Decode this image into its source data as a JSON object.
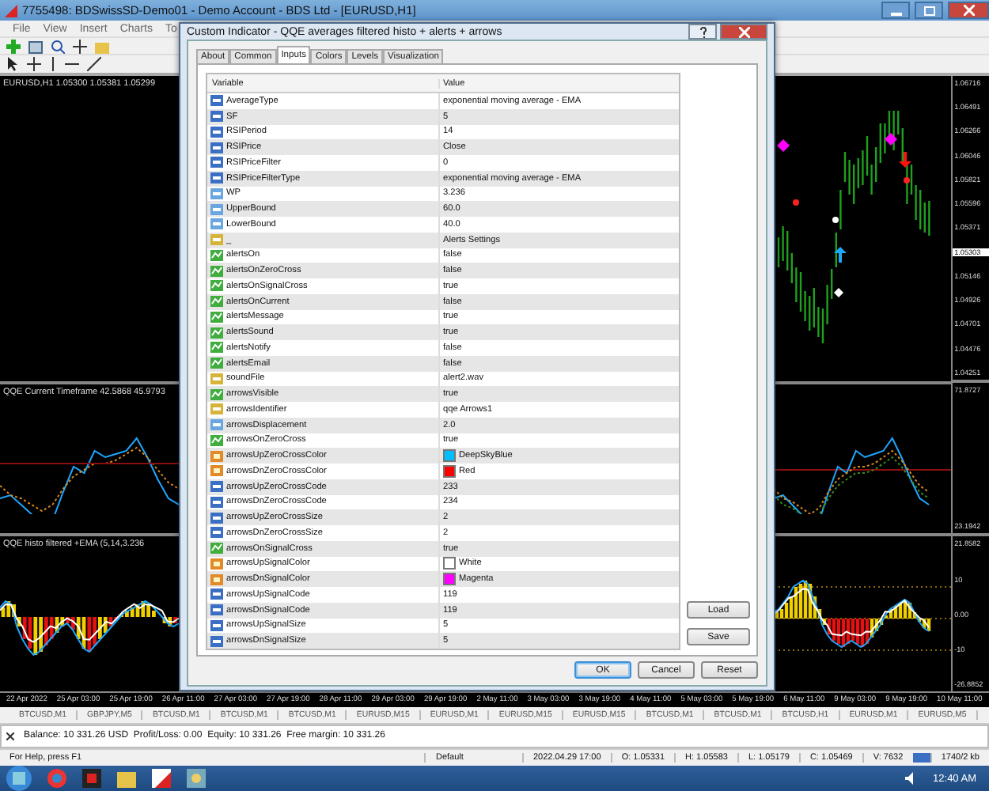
{
  "window": {
    "title": "7755498: BDSwissSD-Demo01 - Demo Account - BDS Ltd - [EURUSD,H1]"
  },
  "menu": [
    "File",
    "View",
    "Insert",
    "Charts",
    "To"
  ],
  "chart": {
    "symbol_info": "EURUSD,H1  1.05300 1.05381 1.05299",
    "price_labels": [
      {
        "text": "1.06716",
        "current": false
      },
      {
        "text": "1.06491",
        "current": false
      },
      {
        "text": "1.06266",
        "current": false
      },
      {
        "text": "1.06046",
        "current": false
      },
      {
        "text": "1.05821",
        "current": false
      },
      {
        "text": "1.05596",
        "current": false
      },
      {
        "text": "1.05371",
        "current": false
      },
      {
        "text": "1.05303",
        "current": true
      },
      {
        "text": "1.05146",
        "current": false
      },
      {
        "text": "1.04926",
        "current": false
      },
      {
        "text": "1.04701",
        "current": false
      },
      {
        "text": "1.04476",
        "current": false
      },
      {
        "text": "1.04251",
        "current": false
      }
    ],
    "qqe_label": "QQE Current Timeframe 42.5868 45.9793",
    "qqe_axis": [
      "71.8727",
      "23.1942"
    ],
    "histo_label": "QQE histo filtered +EMA (5,14,3.236",
    "histo_axis": [
      "21.8582",
      "10",
      "0.00",
      "-10",
      "-26.8852"
    ],
    "time_labels": [
      "22 Apr 2022",
      "25 Apr 03:00",
      "25 Apr 19:00",
      "26 Apr 11:00",
      "27 Apr 03:00",
      "27 Apr 19:00",
      "28 Apr 11:00",
      "29 Apr 03:00",
      "29 Apr 19:00",
      "2 May 11:00",
      "3 May 03:00",
      "3 May 19:00",
      "4 May 11:00",
      "5 May 03:00",
      "5 May 19:00",
      "6 May 11:00",
      "9 May 03:00",
      "9 May 19:00",
      "10 May 11:00"
    ]
  },
  "dialog": {
    "title": "Custom Indicator - QQE averages filtered histo + alerts + arrows",
    "tabs": [
      {
        "label": "About",
        "selected": false
      },
      {
        "label": "Common",
        "selected": false
      },
      {
        "label": "Inputs",
        "selected": true
      },
      {
        "label": "Colors",
        "selected": false
      },
      {
        "label": "Levels",
        "selected": false
      },
      {
        "label": "Visualization",
        "selected": false
      }
    ],
    "columns": [
      "Variable",
      "Value"
    ],
    "rows": [
      {
        "kind": "int",
        "name": "AverageType",
        "value": "exponential moving average - EMA"
      },
      {
        "kind": "int",
        "name": "SF",
        "value": "5"
      },
      {
        "kind": "int",
        "name": "RSIPeriod",
        "value": "14"
      },
      {
        "kind": "int",
        "name": "RSIPrice",
        "value": "Close"
      },
      {
        "kind": "int",
        "name": "RSIPriceFilter",
        "value": "0"
      },
      {
        "kind": "int",
        "name": "RSIPriceFilterType",
        "value": "exponential moving average - EMA"
      },
      {
        "kind": "double",
        "name": "WP",
        "value": "3.236"
      },
      {
        "kind": "double",
        "name": "UpperBound",
        "value": "60.0"
      },
      {
        "kind": "double",
        "name": "LowerBound",
        "value": "40.0"
      },
      {
        "kind": "string",
        "name": "_",
        "value": "Alerts Settings"
      },
      {
        "kind": "bool",
        "name": "alertsOn",
        "value": "false"
      },
      {
        "kind": "bool",
        "name": "alertsOnZeroCross",
        "value": "false"
      },
      {
        "kind": "bool",
        "name": "alertsOnSignalCross",
        "value": "true"
      },
      {
        "kind": "bool",
        "name": "alertsOnCurrent",
        "value": "false"
      },
      {
        "kind": "bool",
        "name": "alertsMessage",
        "value": "true"
      },
      {
        "kind": "bool",
        "name": "alertsSound",
        "value": "true"
      },
      {
        "kind": "bool",
        "name": "alertsNotify",
        "value": "false"
      },
      {
        "kind": "bool",
        "name": "alertsEmail",
        "value": "false"
      },
      {
        "kind": "string",
        "name": "soundFile",
        "value": "alert2.wav"
      },
      {
        "kind": "bool",
        "name": "arrowsVisible",
        "value": "true"
      },
      {
        "kind": "string",
        "name": "arrowsIdentifier",
        "value": "qqe Arrows1"
      },
      {
        "kind": "double",
        "name": "arrowsDisplacement",
        "value": "2.0"
      },
      {
        "kind": "bool",
        "name": "arrowsOnZeroCross",
        "value": "true"
      },
      {
        "kind": "color",
        "name": "arrowsUpZeroCrossColor",
        "value": "DeepSkyBlue",
        "color": "#00bfff"
      },
      {
        "kind": "color",
        "name": "arrowsDnZeroCrossColor",
        "value": "Red",
        "color": "#ff0000"
      },
      {
        "kind": "int",
        "name": "arrowsUpZeroCrossCode",
        "value": "233"
      },
      {
        "kind": "int",
        "name": "arrowsDnZeroCrossCode",
        "value": "234"
      },
      {
        "kind": "int",
        "name": "arrowsUpZeroCrossSize",
        "value": "2"
      },
      {
        "kind": "int",
        "name": "arrowsDnZeroCrossSize",
        "value": "2"
      },
      {
        "kind": "bool",
        "name": "arrowsOnSignalCross",
        "value": "true"
      },
      {
        "kind": "color",
        "name": "arrowsUpSignalColor",
        "value": "White",
        "color": "#ffffff"
      },
      {
        "kind": "color",
        "name": "arrowsDnSignalColor",
        "value": "Magenta",
        "color": "#ff00ff"
      },
      {
        "kind": "int",
        "name": "arrowsUpSignalCode",
        "value": "119"
      },
      {
        "kind": "int",
        "name": "arrowsDnSignalCode",
        "value": "119"
      },
      {
        "kind": "int",
        "name": "arrowsUpSignalSize",
        "value": "5"
      },
      {
        "kind": "int",
        "name": "arrowsDnSignalSize",
        "value": "5"
      }
    ],
    "side_buttons": [
      "Load",
      "Save"
    ],
    "footer_buttons": [
      {
        "label": "OK",
        "default": true
      },
      {
        "label": "Cancel",
        "default": false
      },
      {
        "label": "Reset",
        "default": false
      }
    ]
  },
  "symbol_tabs": [
    "BTCUSD,M1",
    "GBPJPY,M5",
    "BTCUSD,M1",
    "BTCUSD,M1",
    "BTCUSD,M1",
    "EURUSD,M15",
    "EURUSD,M1",
    "EURUSD,M15",
    "EURUSD,M15",
    "BTCUSD,M1",
    "BTCUSD,M1",
    "BTCUSD,H1",
    "EURUSD,M1",
    "EURUSD,M5"
  ],
  "terminal": {
    "account": "Balance: 10 331.26 USD  Profit/Loss: 0.00  Equity: 10 331.26  Free margin: 10 331.26"
  },
  "status_bar": {
    "help": "For Help, press F1",
    "profile": "Default",
    "time": "2022.04.29 17:00",
    "open": "O: 1.05331",
    "high": "H: 1.05583",
    "low": "L: 1.05179",
    "close": "C: 1.05469",
    "volume": "V: 7632",
    "traffic": "1740/2 kb"
  },
  "taskbar": {
    "clock": "12:40 AM"
  }
}
